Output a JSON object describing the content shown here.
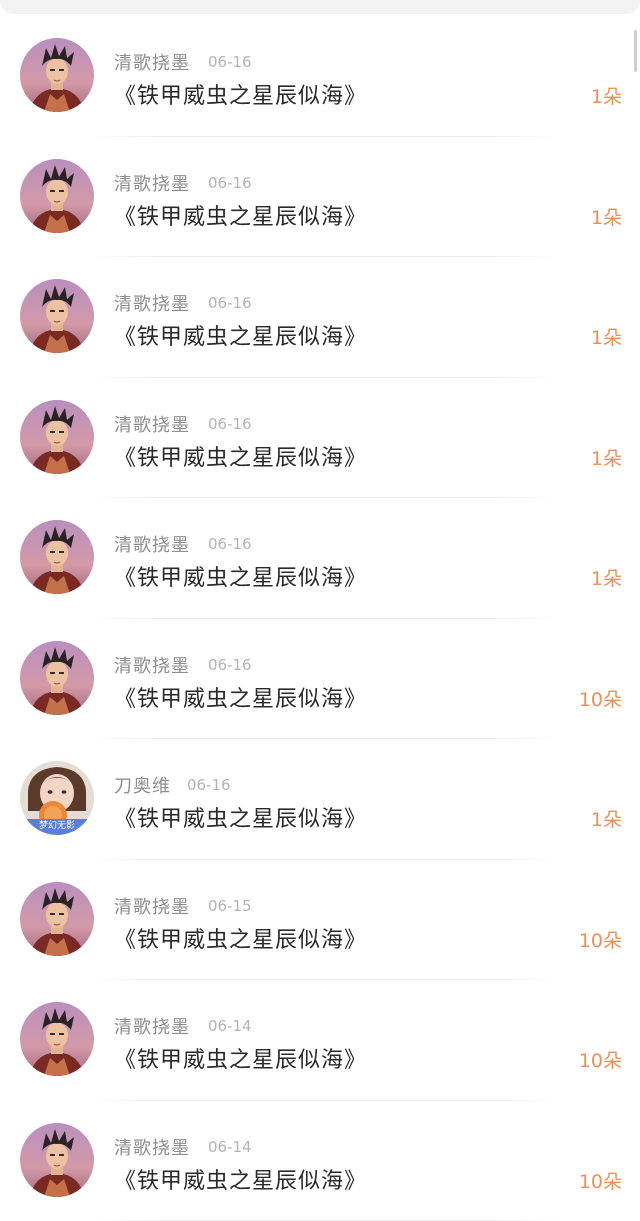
{
  "comments": [
    {
      "user": "清歌挠墨",
      "date": "06-16",
      "title": "《铁甲威虫之星辰似海》",
      "count": "1朵",
      "avatar": "male-warrior"
    },
    {
      "user": "清歌挠墨",
      "date": "06-16",
      "title": "《铁甲威虫之星辰似海》",
      "count": "1朵",
      "avatar": "male-warrior"
    },
    {
      "user": "清歌挠墨",
      "date": "06-16",
      "title": "《铁甲威虫之星辰似海》",
      "count": "1朵",
      "avatar": "male-warrior"
    },
    {
      "user": "清歌挠墨",
      "date": "06-16",
      "title": "《铁甲威虫之星辰似海》",
      "count": "1朵",
      "avatar": "male-warrior"
    },
    {
      "user": "清歌挠墨",
      "date": "06-16",
      "title": "《铁甲威虫之星辰似海》",
      "count": "1朵",
      "avatar": "male-warrior"
    },
    {
      "user": "清歌挠墨",
      "date": "06-16",
      "title": "《铁甲威虫之星辰似海》",
      "count": "10朵",
      "avatar": "male-warrior"
    },
    {
      "user": "刀奥维",
      "date": "06-16",
      "title": "《铁甲威虫之星辰似海》",
      "count": "1朵",
      "avatar": "girl-photo",
      "avatar_text": "梦幻无影"
    },
    {
      "user": "清歌挠墨",
      "date": "06-15",
      "title": "《铁甲威虫之星辰似海》",
      "count": "10朵",
      "avatar": "male-warrior"
    },
    {
      "user": "清歌挠墨",
      "date": "06-14",
      "title": "《铁甲威虫之星辰似海》",
      "count": "10朵",
      "avatar": "male-warrior"
    },
    {
      "user": "清歌挠墨",
      "date": "06-14",
      "title": "《铁甲威虫之星辰似海》",
      "count": "10朵",
      "avatar": "male-warrior"
    }
  ],
  "colors": {
    "accent": "#e9915a",
    "username": "#8e8e8e",
    "date": "#b4b4b4",
    "title": "#2a2a2a"
  }
}
